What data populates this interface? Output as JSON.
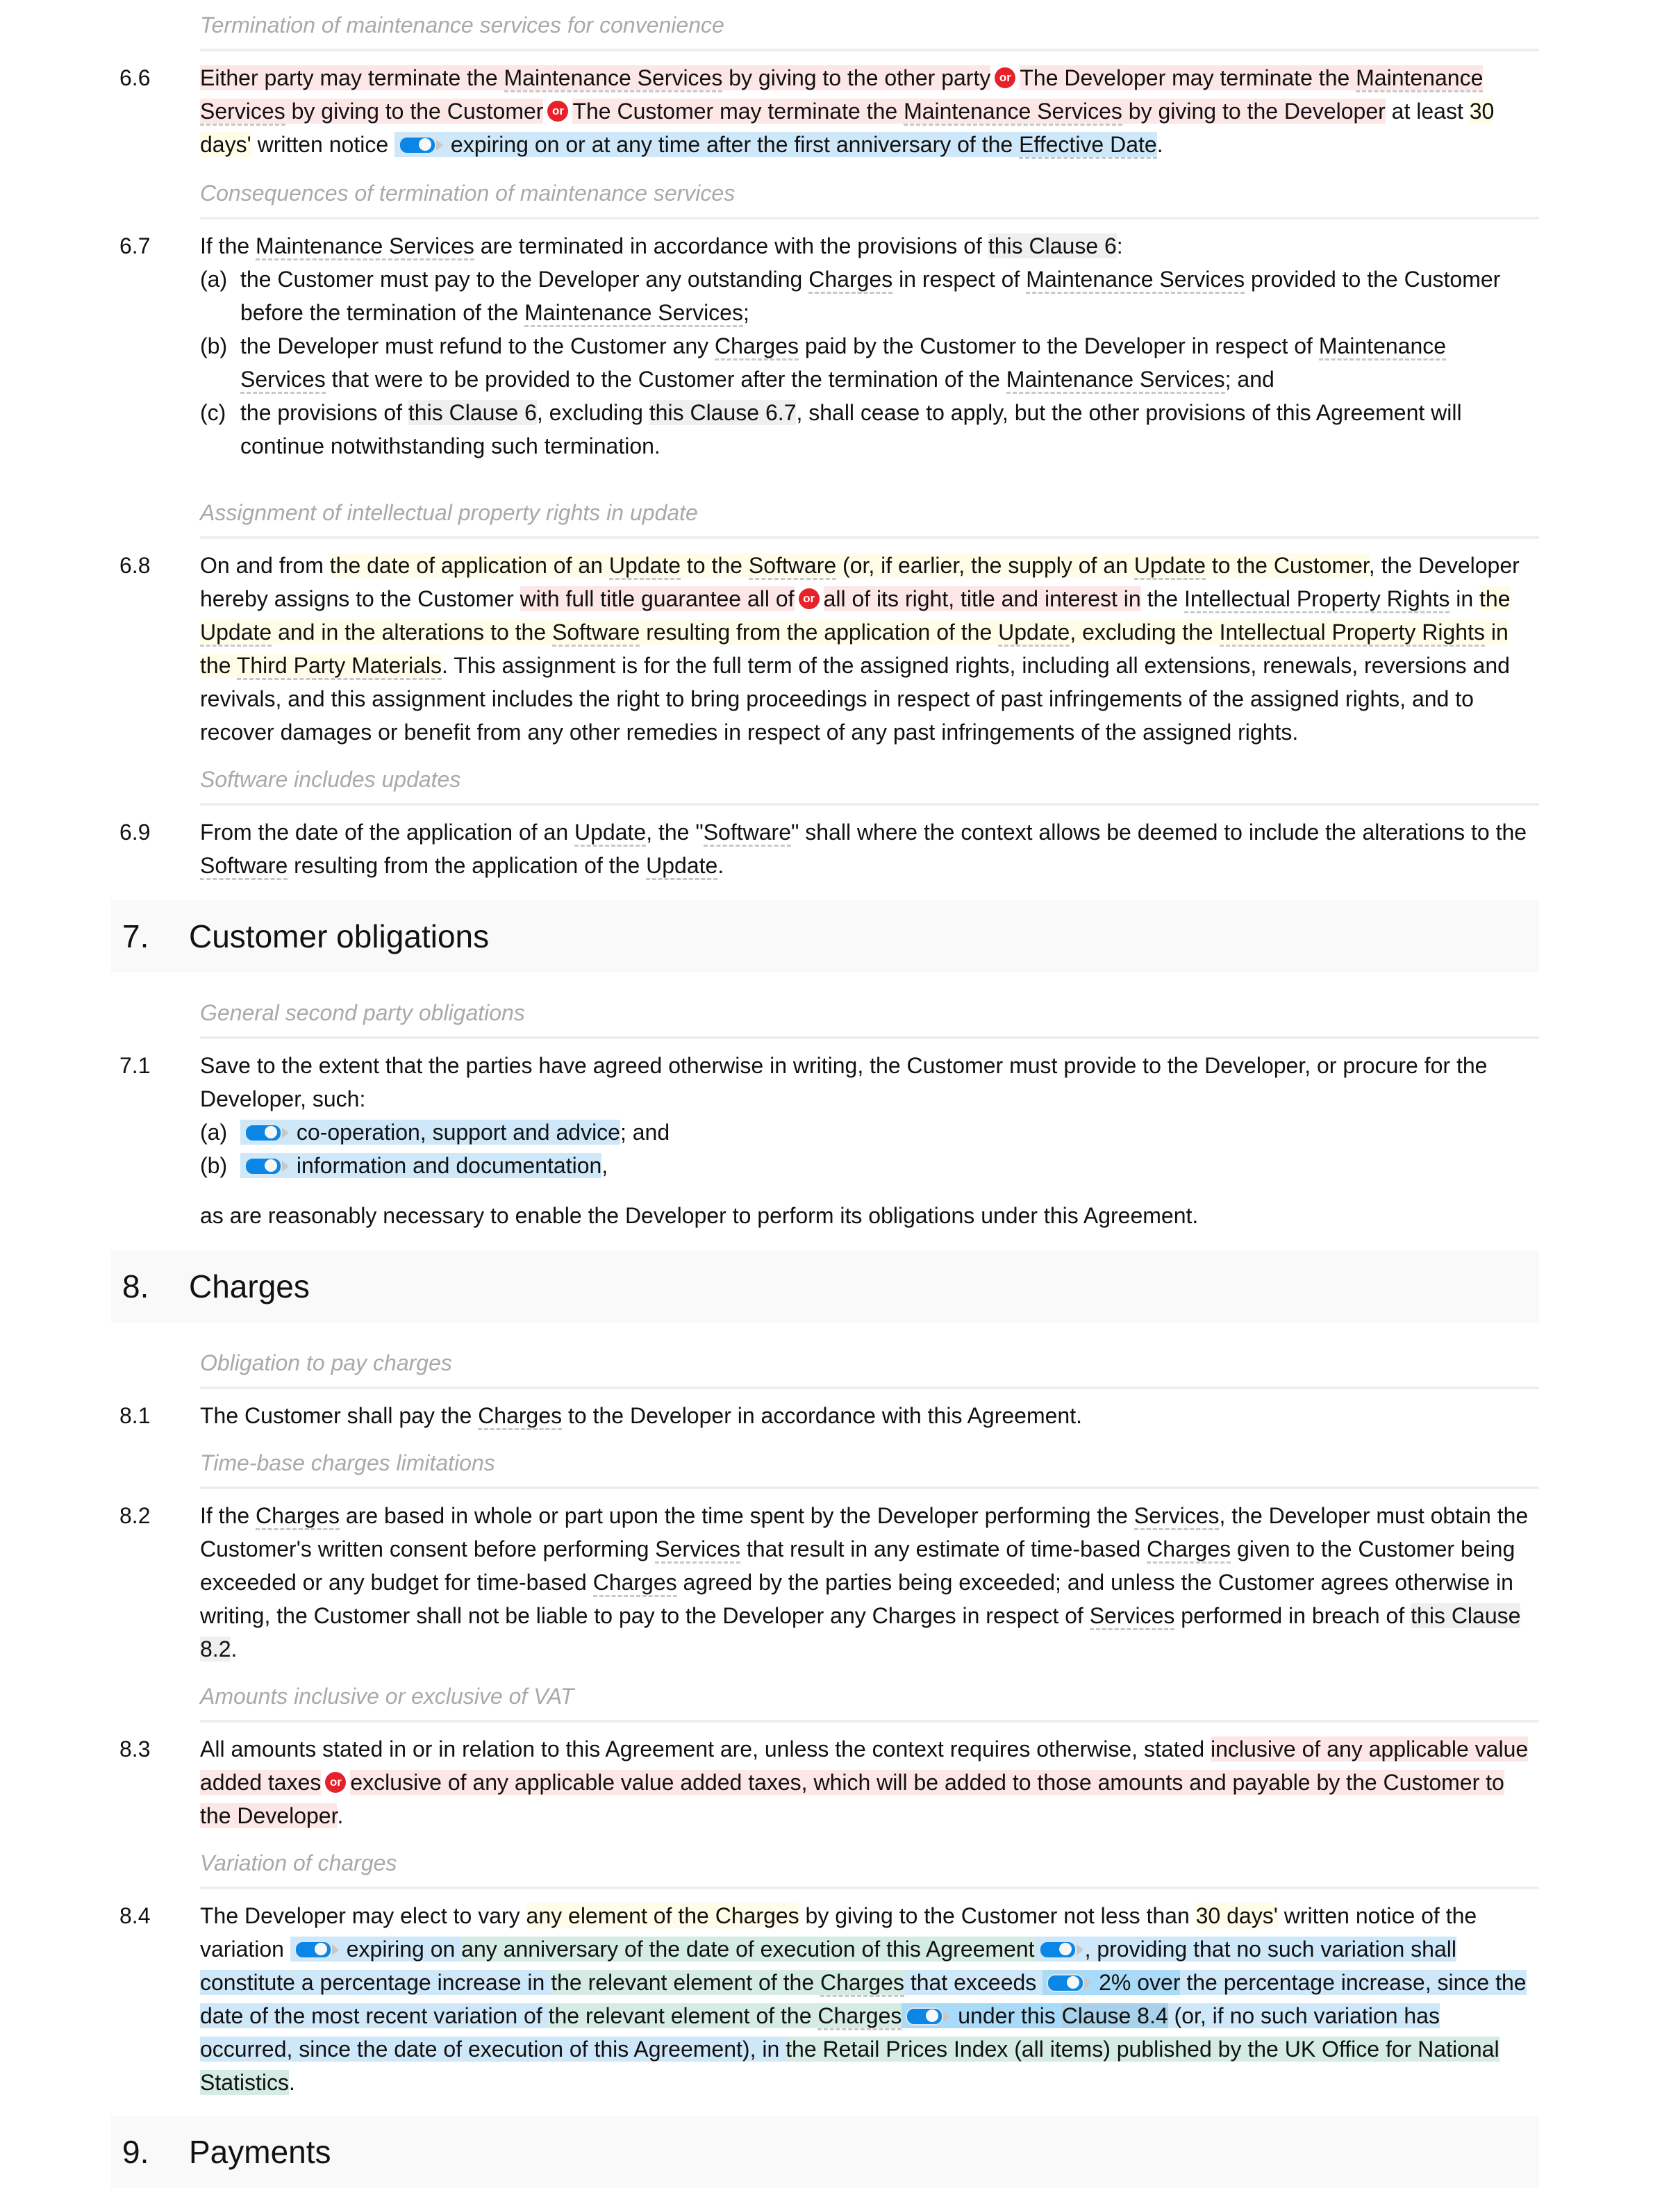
{
  "clause_6_6": {
    "subhead": "Termination of maintenance services for convenience",
    "num": "6.6",
    "opt1": "Either party may terminate the ",
    "ms1": "Maintenance Services",
    "opt1b": " by giving to the other party",
    "opt2": "The Developer may terminate the ",
    "ms2": "Maintenance Services",
    "opt2b": " by giving to the Customer",
    "opt3": "The Customer may terminate the ",
    "ms3": "Maintenance Services",
    "opt3b": " by giving to the Developer",
    "t1": " at least ",
    "days": "30 days'",
    "t2": " written notice ",
    "tog": "expiring on or at any time after the first anniversary of the ",
    "eff": "Effective Date",
    "end": "."
  },
  "clause_6_7": {
    "subhead": "Consequences of termination of maintenance services",
    "num": "6.7",
    "t1": "If the ",
    "ms": "Maintenance Services",
    "t2": " are terminated in accordance with the provisions of ",
    "ref": "this Clause 6",
    "t3": ":",
    "a_lbl": "(a)",
    "a1": "the Customer must pay to the Developer any outstanding ",
    "a_ch": "Charges",
    "a2": " in respect of ",
    "a_ms": "Maintenance Services",
    "a3": " provided to the Customer before the termination of the ",
    "a_ms2": "Maintenance Services",
    "a4": ";",
    "b_lbl": "(b)",
    "b1": "the Developer must refund to the Customer any ",
    "b_ch": "Charges",
    "b2": " paid by the Customer to the Developer in respect of ",
    "b_ms": "Maintenance Services",
    "b3": " that were to be provided to the Customer after the termination of the ",
    "b_ms2": "Maintenance Services",
    "b4": "; and",
    "c_lbl": "(c)",
    "c1": "the provisions of ",
    "c_ref1": "this Clause 6",
    "c2": ", excluding ",
    "c_ref2": "this Clause 6.7",
    "c3": ", shall cease to apply, but the other provisions of this Agreement will continue notwithstanding such termination."
  },
  "clause_6_8": {
    "subhead": "Assignment of intellectual property rights in update",
    "num": "6.8",
    "t1": "On and from ",
    "v1": "the date of application of an ",
    "upd1": "Update",
    "v2": " to the ",
    "sw1": "Software",
    "v3": " (or, if earlier, the supply of an ",
    "upd2": "Update",
    "v4": " to the Customer",
    "t2": ", the Developer hereby assigns to the Customer ",
    "o1": "with full title guarantee all of",
    "o2": "all of its right, title and interest in",
    "t3": " the ",
    "ipr1": "Intellectual Property Rights",
    "t4": " in ",
    "w1": "the ",
    "upd3": "Update",
    "w2": " and in the alterations to the ",
    "sw2": "Software",
    "w3": " resulting from the application of the ",
    "upd4": "Update",
    "w4": ", excluding the ",
    "ipr2": "Intellectual Property Rights",
    "w5": " in the ",
    "tpm": "Third Party Materials",
    "t5": ". This assignment is for the full term of the assigned rights, including all extensions, renewals, reversions and revivals, and this assignment includes the right to bring proceedings in respect of past infringements of the assigned rights, and to recover damages or benefit from any other remedies in respect of any past infringements of the assigned rights."
  },
  "clause_6_9": {
    "subhead": "Software includes updates",
    "num": "6.9",
    "t1": "From the date of the application of an ",
    "upd1": "Update",
    "t2": ", the \"",
    "sw1": "Software",
    "t3": "\" shall where the context allows be deemed to include the alterations to the ",
    "sw2": "Software",
    "t4": " resulting from the application of the ",
    "upd2": "Update",
    "t5": "."
  },
  "section_7": {
    "num": "7.",
    "title": "Customer obligations"
  },
  "clause_7_1": {
    "subhead": "General second party obligations",
    "num": "7.1",
    "t1": "Save to the extent that the parties have agreed otherwise in writing, the Customer must provide to the Developer, or procure for the Developer, such:",
    "a_lbl": "(a)",
    "a": "co-operation, support and advice",
    "a_end": "; and",
    "b_lbl": "(b)",
    "b": "information and documentation",
    "b_end": ",",
    "tail": "as are reasonably necessary to enable the Developer to perform its obligations under this Agreement."
  },
  "section_8": {
    "num": "8.",
    "title": "Charges"
  },
  "clause_8_1": {
    "subhead": "Obligation to pay charges",
    "num": "8.1",
    "t1": "The Customer shall pay the ",
    "ch": "Charges",
    "t2": " to the Developer in accordance with this Agreement."
  },
  "clause_8_2": {
    "subhead": "Time-base charges limitations",
    "num": "8.2",
    "t1": "If the ",
    "ch1": "Charges",
    "t2": " are based in whole or part upon the time spent by the Developer performing the ",
    "sv1": "Services",
    "t3": ", the Developer must obtain the Customer's written consent before performing ",
    "sv2": "Services",
    "t4": " that result in any estimate of time-based ",
    "ch2": "Charges",
    "t5": " given to the Customer being exceeded or any budget for time-based ",
    "ch3": "Charges",
    "t6": " agreed by the parties being exceeded; and unless the Customer agrees otherwise in writing, the Customer shall not be liable to pay to the Developer any Charges in respect of ",
    "sv3": "Services",
    "t7": " performed in breach of ",
    "ref": "this Clause 8.2",
    "t8": "."
  },
  "clause_8_3": {
    "subhead": "Amounts inclusive or exclusive of VAT",
    "num": "8.3",
    "t1": "All amounts stated in or in relation to this Agreement are, unless the context requires otherwise, stated ",
    "o1": "inclusive of any applicable value added taxes",
    "o2": "exclusive of any applicable value added taxes, which will be added to those amounts and payable by the Customer to the Developer",
    "t2": "."
  },
  "clause_8_4": {
    "subhead": "Variation of charges",
    "num": "8.4",
    "t1": "The Developer may elect to vary ",
    "v1": "any element of the Charges",
    "t2": " by giving to the Customer not less than ",
    "days": "30 days'",
    "t3": " written notice of the variation ",
    "g0": "expiring on ",
    "g1": "any anniversary of the date of execution of this Agreement",
    "b1": ", providing that no such variation shall constitute a percentage increase in ",
    "g2a": "the relevant element of the ",
    "ch1": "Charges",
    "b2": " that exceeds ",
    "pct": "2%",
    "b3": " over",
    "b4": " the percentage increase, since the date of the most recent variation of ",
    "g3a": "the relevant element of the ",
    "ch2": "Charges",
    "b5": " under this ",
    "ref": "Clause 8.4",
    "b6": " (or, if no such variation has occurred, since the date of execution of this Agreement), in ",
    "g4": "the Retail Prices Index (all items) published by the UK Office for National Statistics",
    "b7": "."
  },
  "section_9": {
    "num": "9.",
    "title": "Payments"
  },
  "icons": {
    "or_badge": "or",
    "toggle": "toggle-on-icon"
  },
  "colors": {
    "option_bg": "#fde6e6",
    "variable_bg": "#fffde8",
    "toggle_bg": "#cfe8f9",
    "nested_bg": "#d4ece3",
    "or_badge": "#e8202a",
    "toggle_track": "#0a86e6"
  }
}
